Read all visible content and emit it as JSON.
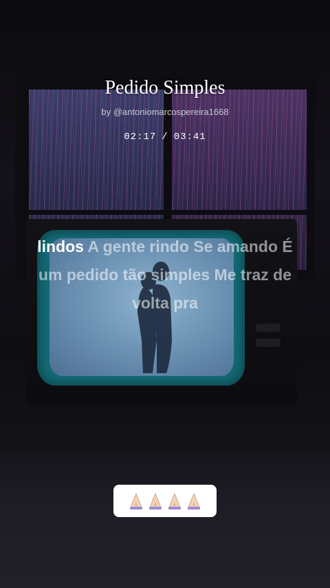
{
  "song": {
    "title": "Pedido Simples",
    "author": "by @antoniomarcospereira1668",
    "current_time": "02:17",
    "separator": "/",
    "total_time": "03:41"
  },
  "lyrics": {
    "current_word": "lindos",
    "upcoming": "A gente rindo Se amando É um pedido tão simples Me traz de volta pra"
  },
  "reaction": {
    "emoji_icon": "folded-hands-icon",
    "emoji": "🙏🏻🙏🏻🙏🏻🙏🏻",
    "count": 4
  }
}
